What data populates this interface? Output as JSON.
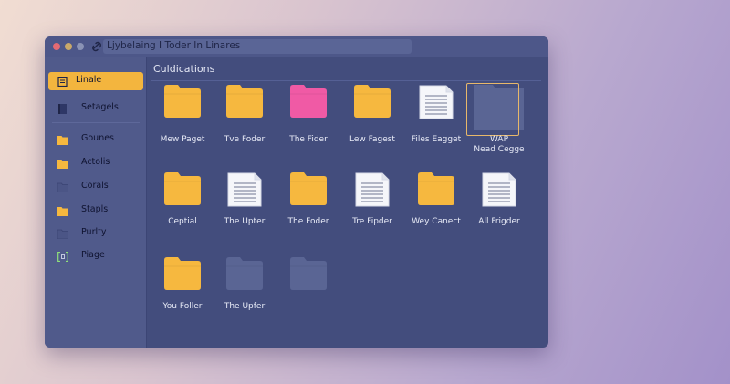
{
  "window": {
    "path_text": "Ljybelaing I Toder  In Linares"
  },
  "sidebar": {
    "items": [
      {
        "label": "Linale",
        "icon": "document-icon",
        "active": true
      },
      {
        "label": "Setagels",
        "icon": "bookmark-icon",
        "active": false
      },
      {
        "label": "Gounes",
        "icon": "folder-icon",
        "active": false
      },
      {
        "label": "Actolis",
        "icon": "folder-icon",
        "active": false
      },
      {
        "label": "Corals",
        "icon": "folder-outline-icon",
        "active": false
      },
      {
        "label": "Stapls",
        "icon": "folder-icon",
        "active": false
      },
      {
        "label": "Purlty",
        "icon": "folder-outline-icon",
        "active": false
      },
      {
        "label": "Piage",
        "icon": "bracket-icon",
        "active": false
      }
    ]
  },
  "main": {
    "heading": "Culdications",
    "items": [
      {
        "label": "Mew Paget",
        "type": "folder-yellow"
      },
      {
        "label": "Tve Foder",
        "type": "folder-yellow"
      },
      {
        "label": "The Fider",
        "type": "folder-pink"
      },
      {
        "label": "Lew Fagest",
        "type": "folder-yellow"
      },
      {
        "label": "Files Eagget",
        "type": "document"
      },
      {
        "label": "WAP\nNead Cegge",
        "type": "folder-selected"
      },
      {
        "label": "Ceptial",
        "type": "folder-yellow"
      },
      {
        "label": "The Upter",
        "type": "document"
      },
      {
        "label": "The Foder",
        "type": "folder-yellow"
      },
      {
        "label": "Tre Fipder",
        "type": "document"
      },
      {
        "label": "Wey Canect",
        "type": "folder-yellow"
      },
      {
        "label": "All Frigder",
        "type": "document"
      },
      {
        "label": "You Foller",
        "type": "folder-yellow"
      },
      {
        "label": "The Upfer",
        "type": "folder-muted"
      },
      {
        "label": "",
        "type": "folder-muted"
      }
    ]
  },
  "colors": {
    "folder_yellow": "#f6b83f",
    "folder_pink": "#f05aa5",
    "folder_muted": "#5a6594",
    "accent": "#f3b53e",
    "window_bg": "#434d7d"
  }
}
